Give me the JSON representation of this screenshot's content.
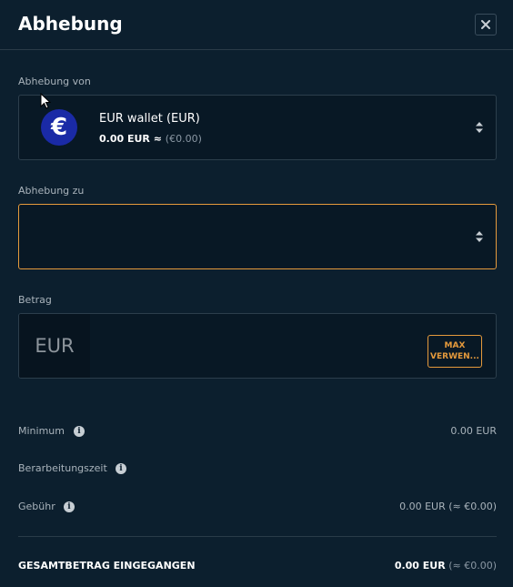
{
  "modal": {
    "title": "Abhebung",
    "close_icon": "close-icon"
  },
  "from": {
    "label": "Abhebung von",
    "wallet_name": "EUR wallet (EUR)",
    "balance": "0.00 EUR",
    "approx_sign": " ≈ ",
    "balance_converted": "(€0.00)",
    "coin_symbol": "€",
    "coin_color": "#1a2aa6"
  },
  "to": {
    "label": "Abhebung zu",
    "value": ""
  },
  "amount": {
    "label": "Betrag",
    "currency": "EUR",
    "value": "",
    "max_button_line1": "MAX",
    "max_button_line2": "VERWEN..."
  },
  "details": {
    "minimum_label": "Minimum",
    "minimum_value": "0.00 EUR",
    "processing_label": "Berarbeitungszeit",
    "processing_value": "",
    "fee_label": "Gebühr",
    "fee_value": "0.00 EUR (≈ €0.00)"
  },
  "total": {
    "label": "GESAMTBETRAG EINGEGANGEN",
    "value": "0.00 EUR",
    "converted": " (≈ €0.00)"
  },
  "colors": {
    "accent": "#e59a3c",
    "background": "#0c1f2e"
  }
}
